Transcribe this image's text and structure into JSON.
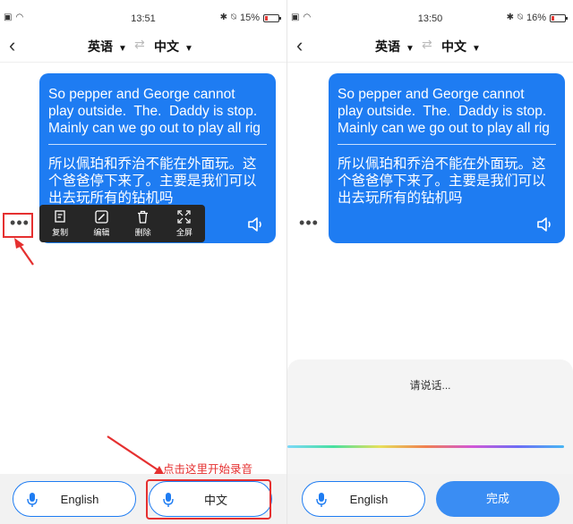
{
  "left": {
    "status": {
      "time": "13:51",
      "battery": "15%",
      "battery_level": 0.15
    },
    "nav": {
      "source_lang": "英语",
      "target_lang": "中文"
    },
    "message": {
      "english": "So pepper and George cannot\nplay outside.  The.  Daddy is stop.\nMainly can we go out to play all rig",
      "chinese": "所以佩珀和乔治不能在外面玩。这\n个爸爸停下来了。主要是我们可以\n出去玩所有的钻机吗"
    },
    "more": "•••",
    "menu": [
      {
        "label": "复制",
        "icon": "copy-icon"
      },
      {
        "label": "编辑",
        "icon": "edit-icon"
      },
      {
        "label": "删除",
        "icon": "delete-icon"
      },
      {
        "label": "全屏",
        "icon": "fullscreen-icon"
      }
    ],
    "hint": "点击这里开始录音",
    "bottom": {
      "english_button": "English",
      "chinese_button": "中文"
    }
  },
  "right": {
    "status": {
      "time": "13:50",
      "battery": "16%",
      "battery_level": 0.16
    },
    "nav": {
      "source_lang": "英语",
      "target_lang": "中文"
    },
    "message": {
      "english": "So pepper and George cannot\nplay outside.  The.  Daddy is stop.\nMainly can we go out to play all rig",
      "chinese": "所以佩珀和乔治不能在外面玩。这\n个爸爸停下来了。主要是我们可以\n出去玩所有的钻机吗"
    },
    "more": "•••",
    "prompt": "请说话...",
    "bottom": {
      "english_button": "English",
      "done_button": "完成"
    }
  },
  "colors": {
    "accent": "#1e7cf2",
    "annotation": "#e53030",
    "menu_bg": "#262626"
  }
}
